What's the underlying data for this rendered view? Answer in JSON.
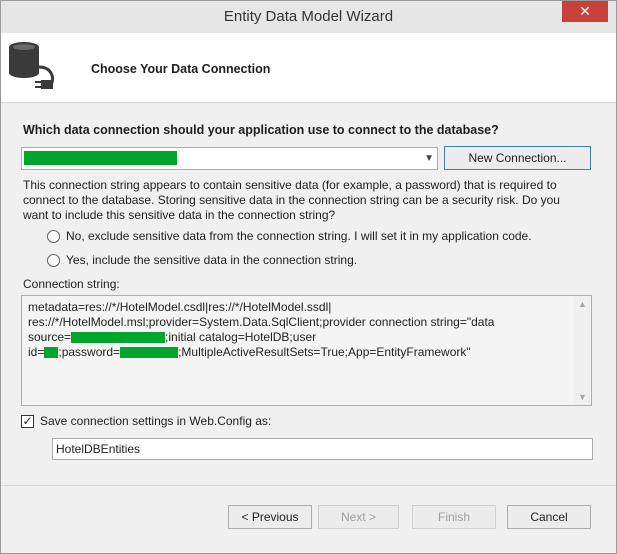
{
  "window": {
    "title": "Entity Data Model Wizard",
    "close_glyph": "✕"
  },
  "header": {
    "title": "Choose Your Data Connection",
    "icon": "database-connection-icon"
  },
  "connection": {
    "question": "Which data connection should your application use to connect to the database?",
    "selected_value": "(redacted)",
    "new_connection_label": "New Connection..."
  },
  "sensitive": {
    "description": "This connection string appears to contain sensitive data (for example, a password) that is required to connect to the database. Storing sensitive data in the connection string can be a security risk. Do you want to include this sensitive data in the connection string?",
    "option_exclude": "No, exclude sensitive data from the connection string. I will set it in my application code.",
    "option_include": "Yes, include the sensitive data in the connection string."
  },
  "connection_string": {
    "label": "Connection string:",
    "line1": "metadata=res://*/HotelModel.csdl|res://*/HotelModel.ssdl|",
    "line2": "res://*/HotelModel.msl;provider=System.Data.SqlClient;provider connection string=\"data",
    "line3_start": "source=",
    "line3_end": ";initial catalog=HotelDB;user",
    "line4_start": "id=",
    "line4_mid": ";password=",
    "line4_end": ";MultipleActiveResultSets=True;App=EntityFramework\""
  },
  "save": {
    "checked": true,
    "check_glyph": "✓",
    "label": "Save connection settings in Web.Config as:",
    "name_value": "HotelDBEntities"
  },
  "buttons": {
    "previous": "< Previous",
    "next": "Next >",
    "finish": "Finish",
    "cancel": "Cancel"
  },
  "colors": {
    "redaction": "#00a52c",
    "close_button": "#c7413a"
  }
}
